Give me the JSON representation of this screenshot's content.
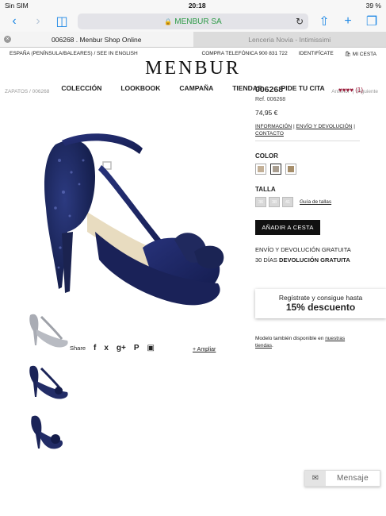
{
  "status_bar": {
    "carrier": "Sin SIM",
    "time": "20:18",
    "battery": "39 %"
  },
  "browser": {
    "url": "MENBUR SA"
  },
  "tabs": [
    {
      "label": "006268 . Menbur Shop Online",
      "active": true
    },
    {
      "label": "Lenceria Novia - Intimissimi",
      "active": false
    }
  ],
  "header": {
    "region": "ESPAÑA (PENÍNSULA/BALEARES) / SEE IN ENGLISH",
    "phone": "COMPRA TELEFÓNICA 900 831 722",
    "login": "IDENTIFÍCATE",
    "cart": "MI CESTA",
    "logo": "MENBUR"
  },
  "nav": [
    "COLECCIÓN",
    "LOOKBOOK",
    "CAMPAÑA",
    "TIENDAS",
    "PIDE TU CITA"
  ],
  "breadcrumb": {
    "path": "ZAPATOS / 006268",
    "prev": "Anterior",
    "next": "Siguiente"
  },
  "product": {
    "name": "006268",
    "reviews_count": "(1)",
    "rating": 4,
    "ref": "Ref. 006268",
    "price": "74,95 €",
    "links": {
      "info": "INFORMACIÓN",
      "shipping": "ENVÍO Y DEVOLUCIÓN",
      "contact": "CONTACTO"
    },
    "color_label": "COLOR",
    "colors": [
      "#c3b097",
      "#a89d8f",
      "#a68e6a"
    ],
    "size_label": "TALLA",
    "sizes": [
      "36",
      "38",
      "41"
    ],
    "size_guide": "Guía de tallas",
    "add_to_cart": "AÑADIR A CESTA",
    "shipping_line1": "ENVÍO Y DEVOLUCIÓN GRATUITA",
    "shipping_line2_pre": "30 DÍAS",
    "shipping_line2_bold": "DEVOLUCIÓN GRATUITA",
    "availability_pre": "Modelo también disponible en",
    "availability_link1": "nuestras",
    "availability_link2": "tiendas",
    "availability_post": "."
  },
  "share": {
    "label": "Share",
    "zoom": "+ Ampliar"
  },
  "promo": {
    "line1": "Regístrate y consigue hasta",
    "line2": "15% descuento"
  },
  "chat": {
    "label": "Mensaje"
  }
}
